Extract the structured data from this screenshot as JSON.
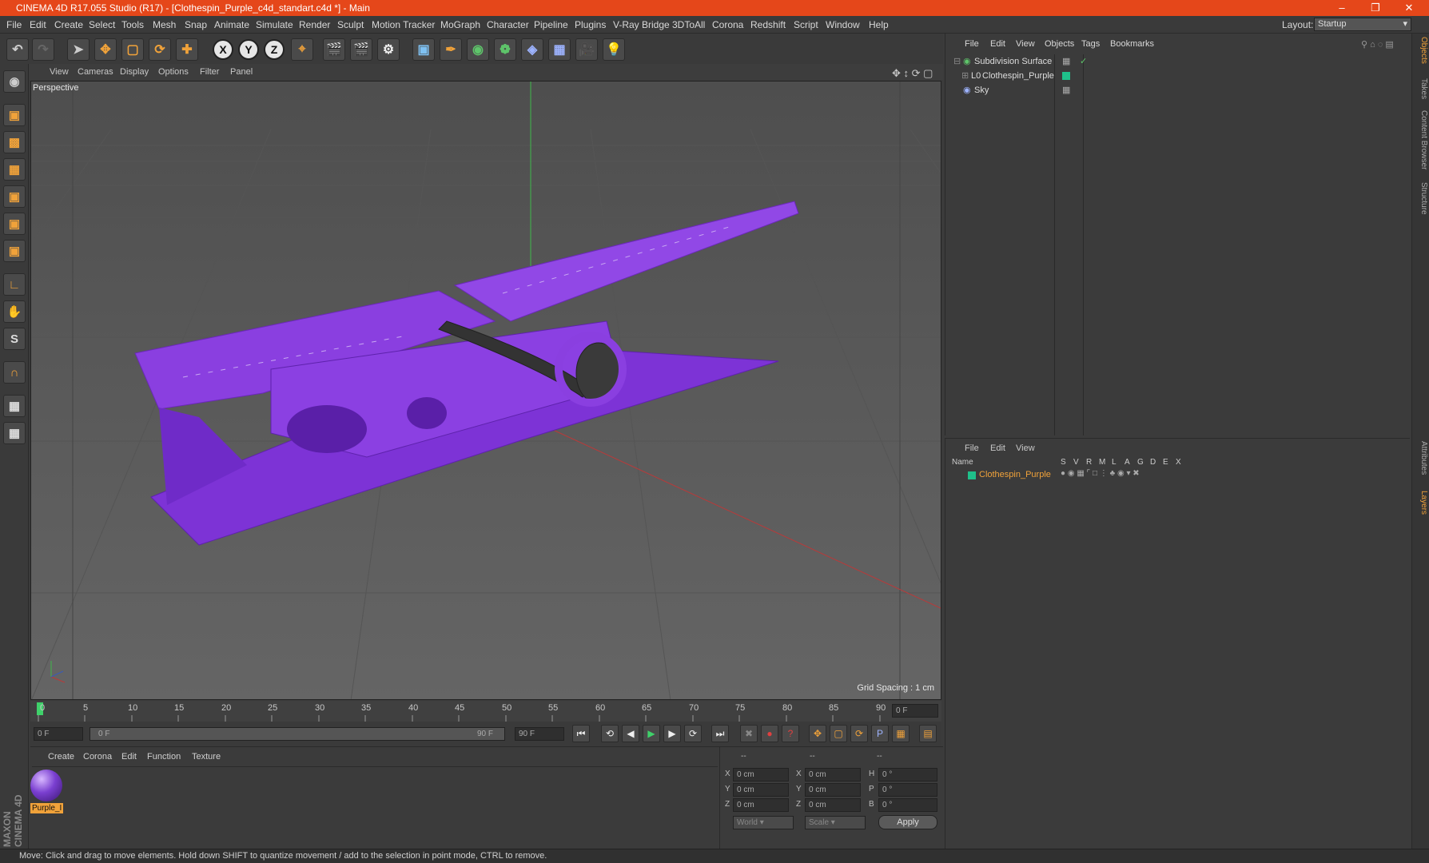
{
  "titlebar": {
    "title": "CINEMA 4D R17.055 Studio (R17) - [Clothespin_Purple_c4d_standart.c4d *] - Main"
  },
  "menu": [
    "File",
    "Edit",
    "Create",
    "Select",
    "Tools",
    "Mesh",
    "Snap",
    "Animate",
    "Simulate",
    "Render",
    "Sculpt",
    "Motion Tracker",
    "MoGraph",
    "Character",
    "Pipeline",
    "Plugins",
    "V-Ray Bridge",
    "3DToAll",
    "Corona",
    "Redshift",
    "Script",
    "Window",
    "Help"
  ],
  "layout": {
    "label": "Layout:",
    "value": "Startup"
  },
  "toolbar_axes": [
    "X",
    "Y",
    "Z"
  ],
  "viewport": {
    "menu": [
      "View",
      "Cameras",
      "Display",
      "Options",
      "Filter",
      "Panel"
    ],
    "label": "Perspective",
    "grid_spacing": "Grid Spacing : 1 cm"
  },
  "timeline": {
    "ticks": [
      "0",
      "5",
      "10",
      "15",
      "20",
      "25",
      "30",
      "35",
      "40",
      "45",
      "50",
      "55",
      "60",
      "65",
      "70",
      "75",
      "80",
      "85",
      "90"
    ],
    "current": "0 F",
    "start": "0 F",
    "slider_start": "0 F",
    "slider_end": "90 F",
    "end": "90 F"
  },
  "material": {
    "menu": [
      "Create",
      "Corona",
      "Edit",
      "Function",
      "Texture"
    ],
    "swatch_label": "Purple_I",
    "color": "#7a3fd0"
  },
  "coords": {
    "header": [
      "--",
      "--",
      "--"
    ],
    "rows": [
      {
        "a": "X",
        "av": "0 cm",
        "b": "X",
        "bv": "0 cm",
        "c": "H",
        "cv": "0 °"
      },
      {
        "a": "Y",
        "av": "0 cm",
        "b": "Y",
        "bv": "0 cm",
        "c": "P",
        "cv": "0 °"
      },
      {
        "a": "Z",
        "av": "0 cm",
        "b": "Z",
        "bv": "0 cm",
        "c": "B",
        "cv": "0 °"
      }
    ],
    "mode1": "World",
    "mode2": "Scale",
    "apply": "Apply"
  },
  "objects": {
    "menu": [
      "File",
      "Edit",
      "View",
      "Objects",
      "Tags",
      "Bookmarks"
    ],
    "items": [
      "Subdivision Surface",
      "Clothespin_Purple",
      "Sky"
    ]
  },
  "layers": {
    "menu": [
      "File",
      "Edit",
      "View"
    ],
    "columns": [
      "Name",
      "S",
      "V",
      "R",
      "M",
      "L",
      "A",
      "G",
      "D",
      "E",
      "X"
    ],
    "items": [
      "Clothespin_Purple"
    ]
  },
  "sidetabs": [
    "Objects",
    "Takes",
    "Content Browser",
    "Structure",
    "Attributes",
    "Layers"
  ],
  "status": "Move: Click and drag to move elements. Hold down SHIFT to quantize movement / add to the selection in point mode, CTRL to remove.",
  "brand": [
    "MAXON",
    "CINEMA 4D"
  ],
  "colors": {
    "accent": "#e5471a",
    "object_purple": "#8a3fe0",
    "highlight": "#f0a23a"
  }
}
